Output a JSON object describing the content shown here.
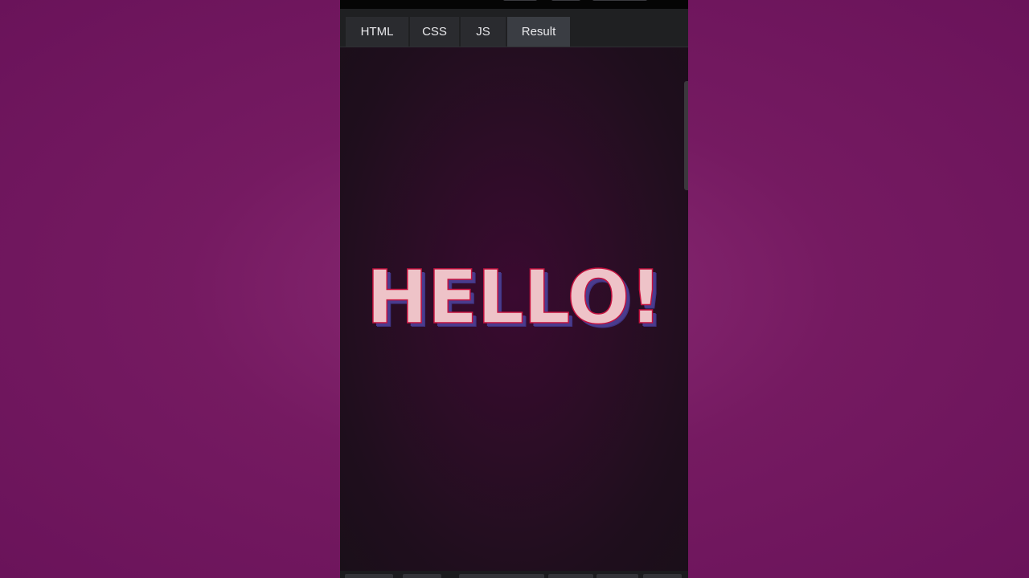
{
  "tabs": [
    {
      "label": "HTML",
      "active": false
    },
    {
      "label": "CSS",
      "active": false
    },
    {
      "label": "JS",
      "active": false
    },
    {
      "label": "Result",
      "active": true
    }
  ],
  "result": {
    "text": "HELLO!"
  },
  "colors": {
    "background": "#751a61",
    "text_fill": "#eec3c8",
    "text_outline": "#c4123f",
    "text_shadow": "#4a3c8e",
    "tab_active": "#3a3d43"
  }
}
